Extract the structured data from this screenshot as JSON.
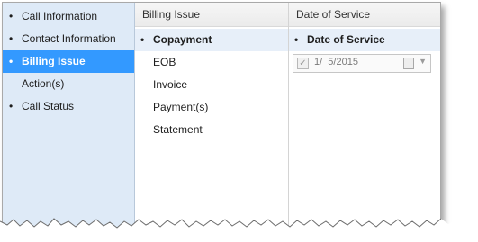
{
  "sidebar": {
    "items": [
      {
        "label": "Call Information"
      },
      {
        "label": "Contact Information"
      },
      {
        "label": "Billing Issue"
      },
      {
        "label": "Action(s)"
      },
      {
        "label": "Call Status"
      }
    ]
  },
  "billing": {
    "header": "Billing Issue",
    "items": [
      {
        "label": "Copayment"
      },
      {
        "label": "EOB"
      },
      {
        "label": "Invoice"
      },
      {
        "label": "Payment(s)"
      },
      {
        "label": "Statement"
      }
    ]
  },
  "dos": {
    "header": "Date of Service",
    "title": "Date of Service",
    "date_value": "1/  5/2015"
  },
  "icons": {
    "bullet": "bullet-icon",
    "checkbox": "checkbox-icon",
    "calendar": "calendar-icon",
    "dropdown": "chevron-down-icon"
  },
  "colors": {
    "selected_nav": "#3399ff",
    "sidebar_bg": "#deeaf7",
    "selected_row": "#e7eff9"
  }
}
